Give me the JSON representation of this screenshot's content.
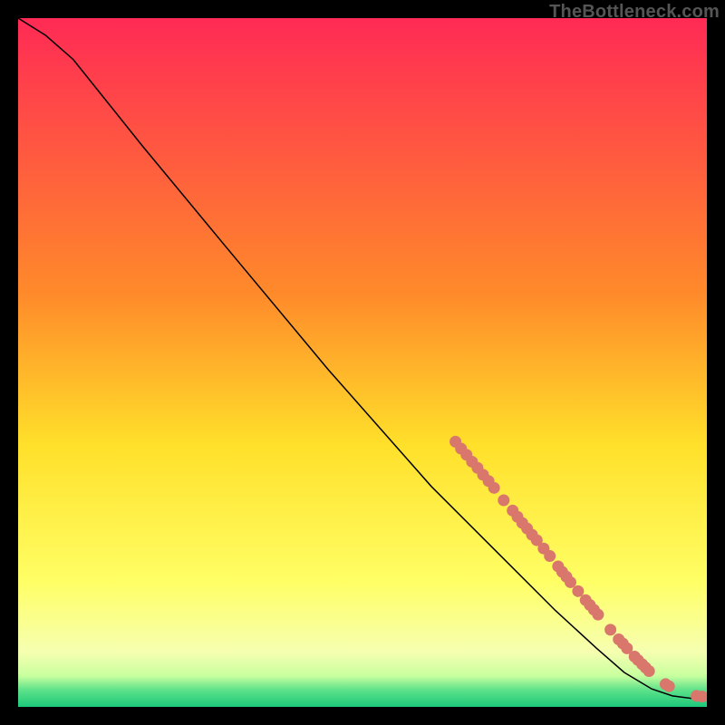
{
  "watermark": {
    "text": "TheBottleneck.com"
  },
  "chart_data": {
    "type": "line",
    "title": "",
    "xlabel": "",
    "ylabel": "",
    "xlim": [
      0,
      100
    ],
    "ylim": [
      0,
      100
    ],
    "background_gradient": {
      "stops": [
        {
          "offset": 0.0,
          "color": "#ff2a55"
        },
        {
          "offset": 0.4,
          "color": "#ff8a2a"
        },
        {
          "offset": 0.62,
          "color": "#ffe02a"
        },
        {
          "offset": 0.82,
          "color": "#ffff66"
        },
        {
          "offset": 0.92,
          "color": "#f6ffb0"
        },
        {
          "offset": 0.955,
          "color": "#c8ff9f"
        },
        {
          "offset": 0.975,
          "color": "#5fe28a"
        },
        {
          "offset": 1.0,
          "color": "#1cc97a"
        }
      ]
    },
    "series": [
      {
        "name": "curve",
        "color": "#000000",
        "width": 1.5,
        "points": [
          {
            "x": 0.0,
            "y": 100.0
          },
          {
            "x": 4.0,
            "y": 97.5
          },
          {
            "x": 8.0,
            "y": 94.0
          },
          {
            "x": 12.0,
            "y": 89.0
          },
          {
            "x": 18.0,
            "y": 81.5
          },
          {
            "x": 30.0,
            "y": 67.0
          },
          {
            "x": 45.0,
            "y": 49.0
          },
          {
            "x": 60.0,
            "y": 32.0
          },
          {
            "x": 70.0,
            "y": 22.0
          },
          {
            "x": 78.0,
            "y": 14.0
          },
          {
            "x": 84.0,
            "y": 8.5
          },
          {
            "x": 88.0,
            "y": 5.0
          },
          {
            "x": 92.0,
            "y": 2.6
          },
          {
            "x": 95.0,
            "y": 1.6
          },
          {
            "x": 98.0,
            "y": 1.2
          },
          {
            "x": 100.0,
            "y": 1.2
          }
        ]
      }
    ],
    "markers": {
      "color": "#d9776d",
      "radius": 6.5,
      "points": [
        {
          "x": 63.5,
          "y": 38.5
        },
        {
          "x": 64.3,
          "y": 37.5
        },
        {
          "x": 65.1,
          "y": 36.6
        },
        {
          "x": 65.9,
          "y": 35.6
        },
        {
          "x": 66.7,
          "y": 34.7
        },
        {
          "x": 67.5,
          "y": 33.7
        },
        {
          "x": 68.3,
          "y": 32.8
        },
        {
          "x": 69.1,
          "y": 31.8
        },
        {
          "x": 70.5,
          "y": 30.0
        },
        {
          "x": 71.8,
          "y": 28.5
        },
        {
          "x": 72.5,
          "y": 27.6
        },
        {
          "x": 73.2,
          "y": 26.7
        },
        {
          "x": 73.9,
          "y": 25.9
        },
        {
          "x": 74.6,
          "y": 25.0
        },
        {
          "x": 75.3,
          "y": 24.2
        },
        {
          "x": 76.3,
          "y": 23.0
        },
        {
          "x": 77.2,
          "y": 21.9
        },
        {
          "x": 78.4,
          "y": 20.4
        },
        {
          "x": 79.0,
          "y": 19.6
        },
        {
          "x": 79.6,
          "y": 18.9
        },
        {
          "x": 80.2,
          "y": 18.1
        },
        {
          "x": 81.3,
          "y": 16.8
        },
        {
          "x": 82.4,
          "y": 15.5
        },
        {
          "x": 83.0,
          "y": 14.8
        },
        {
          "x": 83.6,
          "y": 14.1
        },
        {
          "x": 84.2,
          "y": 13.4
        },
        {
          "x": 86.0,
          "y": 11.2
        },
        {
          "x": 87.2,
          "y": 9.8
        },
        {
          "x": 87.8,
          "y": 9.2
        },
        {
          "x": 88.4,
          "y": 8.5
        },
        {
          "x": 89.5,
          "y": 7.3
        },
        {
          "x": 90.0,
          "y": 6.8
        },
        {
          "x": 90.6,
          "y": 6.2
        },
        {
          "x": 91.1,
          "y": 5.7
        },
        {
          "x": 91.6,
          "y": 5.2
        },
        {
          "x": 94.0,
          "y": 3.3
        },
        {
          "x": 94.5,
          "y": 3.0
        },
        {
          "x": 98.5,
          "y": 1.6
        },
        {
          "x": 99.3,
          "y": 1.5
        }
      ]
    }
  }
}
